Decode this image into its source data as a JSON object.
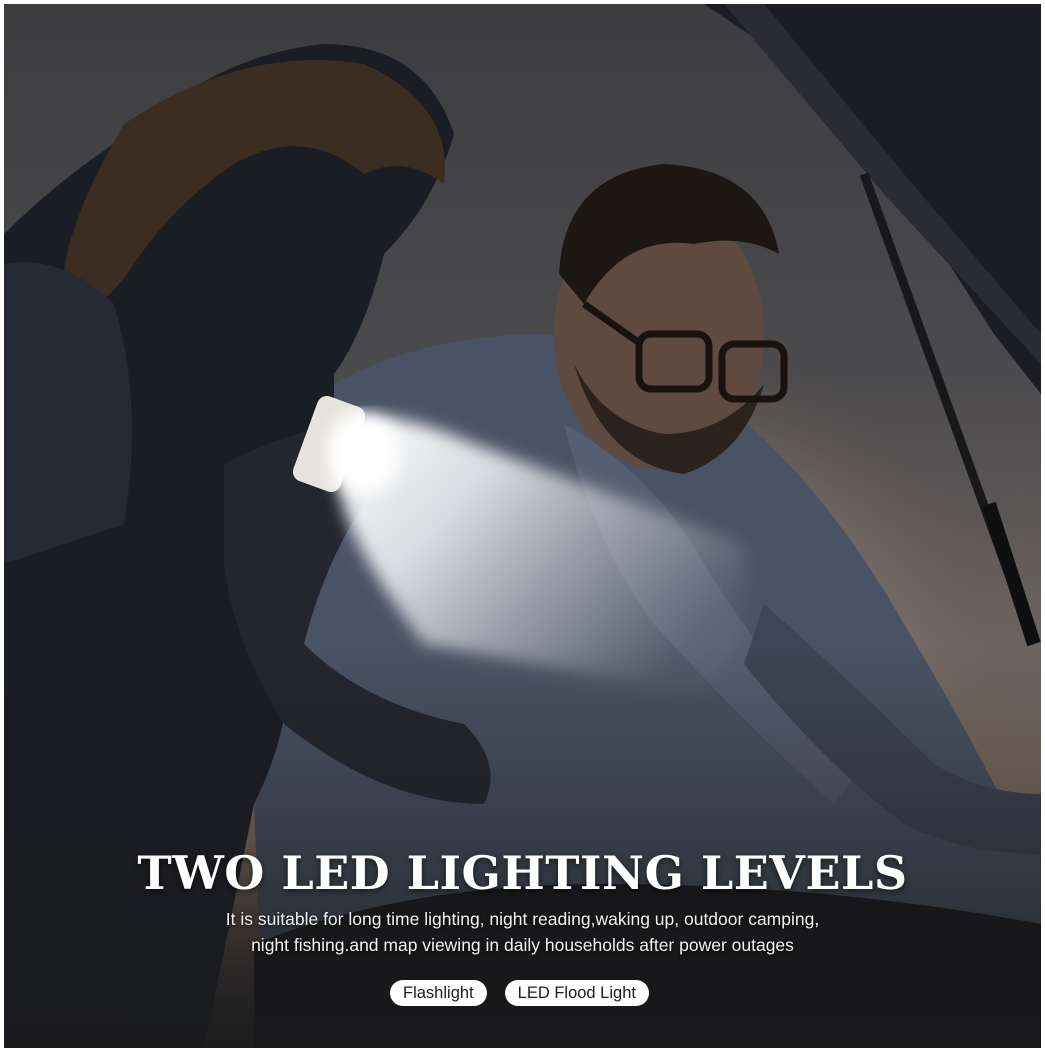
{
  "headline": "TWO LED LIGHTING LEVELS",
  "subtext": {
    "line1": "It is suitable for long time lighting, night reading,waking up, outdoor camping,",
    "line2": "night fishing.and map viewing in daily households after power outages"
  },
  "modes": [
    {
      "label": "Flashlight"
    },
    {
      "label": "LED Flood Light"
    }
  ],
  "colors": {
    "text": "#ffffff",
    "pill_bg": "#ffffff",
    "pill_text": "#1b1b1b",
    "beam": "#f4f6f8"
  }
}
